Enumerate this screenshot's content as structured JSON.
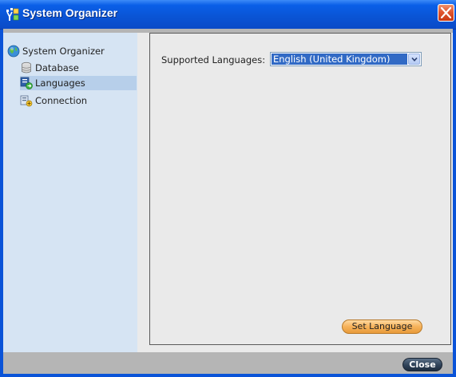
{
  "window": {
    "title": "System Organizer",
    "app_icon": "organizer-app-icon",
    "close_icon": "close-icon"
  },
  "sidebar": {
    "items": [
      {
        "label": "System Organizer",
        "icon": "globe-icon",
        "selected": false
      },
      {
        "label": "Database",
        "icon": "database-icon",
        "selected": false
      },
      {
        "label": "Languages",
        "icon": "languages-icon",
        "selected": true
      },
      {
        "label": "Connection",
        "icon": "connection-icon",
        "selected": false
      }
    ]
  },
  "main": {
    "supported_languages_label": "Supported Languages:",
    "language_select_value": "English (United Kingdom)",
    "set_language_button": "Set Language"
  },
  "footer": {
    "close_button": "Close"
  },
  "colors": {
    "title_bar": "#0A55D6",
    "sidebar_bg": "#D6E4F3",
    "selection": "#316AC5",
    "set_language_button": "#F6B25A",
    "close_button": "#2F4258"
  }
}
